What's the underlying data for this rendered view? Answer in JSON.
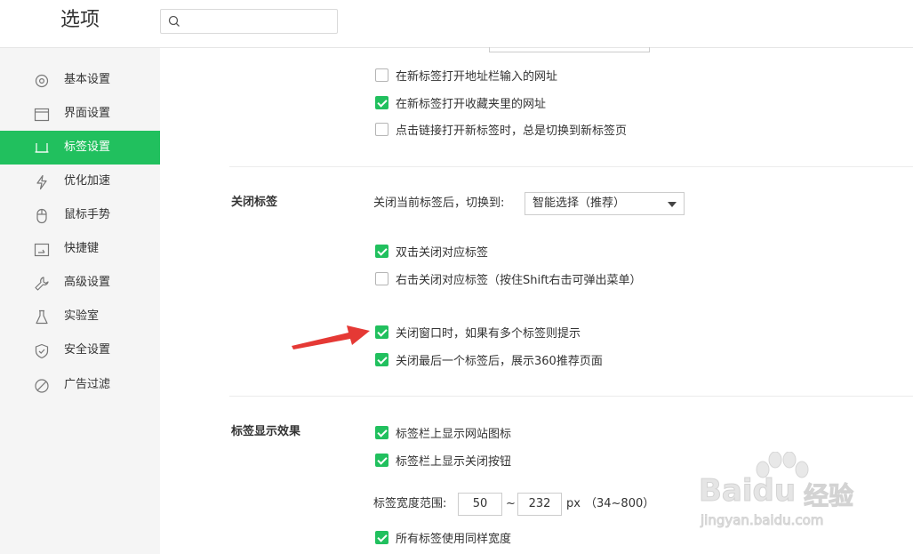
{
  "header": {
    "title": "选项",
    "search_placeholder": ""
  },
  "sidebar": {
    "items": [
      {
        "label": "基本设置",
        "icon": "gear-icon",
        "active": false
      },
      {
        "label": "界面设置",
        "icon": "window-icon",
        "active": false
      },
      {
        "label": "标签设置",
        "icon": "tab-icon",
        "active": true
      },
      {
        "label": "优化加速",
        "icon": "lightning-icon",
        "active": false
      },
      {
        "label": "鼠标手势",
        "icon": "mouse-icon",
        "active": false
      },
      {
        "label": "快捷键",
        "icon": "keyboard-icon",
        "active": false
      },
      {
        "label": "高级设置",
        "icon": "wrench-icon",
        "active": false
      },
      {
        "label": "实验室",
        "icon": "flask-icon",
        "active": false
      },
      {
        "label": "安全设置",
        "icon": "shield-icon",
        "active": false
      },
      {
        "label": "广告过滤",
        "icon": "block-icon",
        "active": false
      }
    ]
  },
  "open_tab": {
    "options": [
      {
        "label": "在新标签打开地址栏输入的网址",
        "checked": false
      },
      {
        "label": "在新标签打开收藏夹里的网址",
        "checked": true
      },
      {
        "label": "点击链接打开新标签时，总是切换到新标签页",
        "checked": false
      }
    ]
  },
  "close_tab": {
    "title": "关闭标签",
    "switch_label": "关闭当前标签后，切换到:",
    "switch_value": "智能选择（推荐）",
    "options": [
      {
        "label": "双击关闭对应标签",
        "checked": true
      },
      {
        "label": "右击关闭对应标签（按住Shift右击可弹出菜单）",
        "checked": false
      },
      {
        "label": "关闭窗口时，如果有多个标签则提示",
        "checked": true
      },
      {
        "label": "关闭最后一个标签后，展示360推荐页面",
        "checked": true
      }
    ]
  },
  "tab_display": {
    "title": "标签显示效果",
    "options": [
      {
        "label": "标签栏上显示网站图标",
        "checked": true
      },
      {
        "label": "标签栏上显示关闭按钮",
        "checked": true
      }
    ],
    "width_label": "标签宽度范围:",
    "width_min": "50",
    "tilde": "~",
    "width_max": "232",
    "unit": "px",
    "range_hint": "（34~800）",
    "same_width": {
      "label": "所有标签使用同样宽度",
      "checked": true
    }
  },
  "colors": {
    "accent": "#21c05e",
    "arrow": "#e53935"
  },
  "watermark": {
    "brand": "Baidu",
    "brand_cn": "经验",
    "url": "jingyan.baidu.com"
  }
}
